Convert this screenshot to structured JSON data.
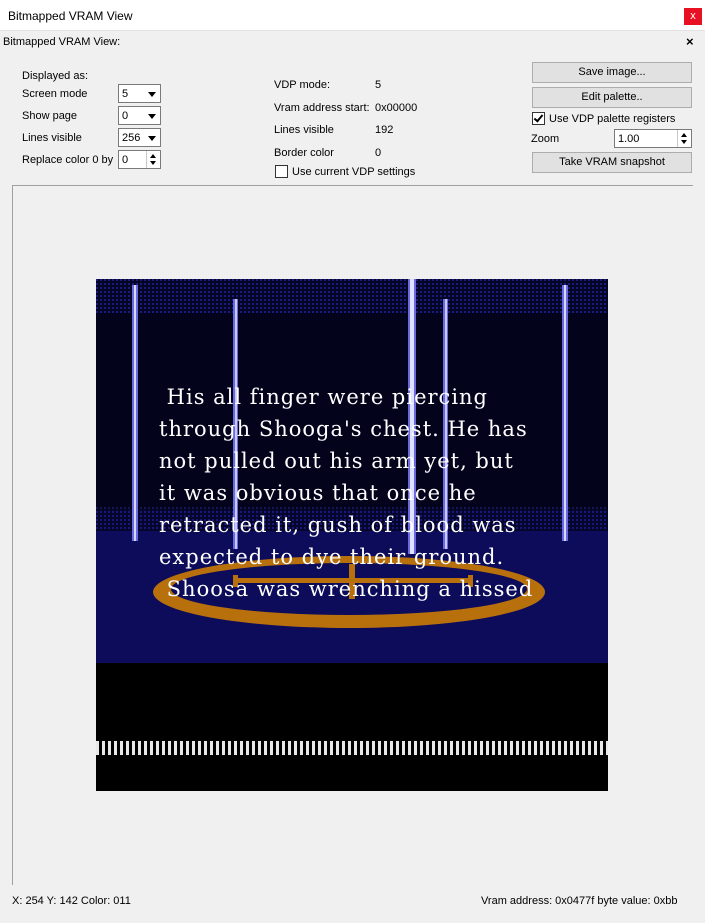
{
  "window": {
    "title": "Bitmapped VRAM View",
    "close_glyph": "x"
  },
  "panel": {
    "title": "Bitmapped VRAM View:",
    "close_glyph": "×"
  },
  "display": {
    "heading": "Displayed as:",
    "screen_mode_label": "Screen mode",
    "screen_mode_value": "5",
    "show_page_label": "Show page",
    "show_page_value": "0",
    "lines_visible_label": "Lines visible",
    "lines_visible_value": "256",
    "replace_color_label": "Replace color 0 by",
    "replace_color_value": "0"
  },
  "vdp": {
    "mode_label": "VDP mode:",
    "mode_value": "5",
    "vram_start_label": "Vram address start:",
    "vram_start_value": "0x00000",
    "lines_visible_label": "Lines visible",
    "lines_visible_value": "192",
    "border_color_label": "Border color",
    "border_color_value": "0",
    "use_current_label": "Use current VDP settings",
    "use_current_checked": false
  },
  "actions": {
    "save_image": "Save image...",
    "edit_palette": "Edit palette..",
    "use_vdp_palette_label": "Use VDP  palette registers",
    "use_vdp_palette_checked": true,
    "zoom_label": "Zoom",
    "zoom_value": "1.00",
    "take_snapshot": "Take VRAM snapshot"
  },
  "screen": {
    "text_lines": [
      " His all finger were piercing",
      "through Shooga's chest. He has",
      "not pulled out his arm yet, but",
      "it was obvious that once he",
      "retracted it, gush of blood was",
      "expected to dye their ground.",
      " Shoosa was wrenching a hissed"
    ],
    "colors": {
      "navy": "#0c0c5a",
      "pillar": "#6a6ae0",
      "ring": "#b8700c",
      "text": "#ffffff"
    }
  },
  "status": {
    "coords": "X:  254  Y:  142  Color:  011",
    "vram": "Vram address:  0x0477f  byte value:  0xbb"
  }
}
